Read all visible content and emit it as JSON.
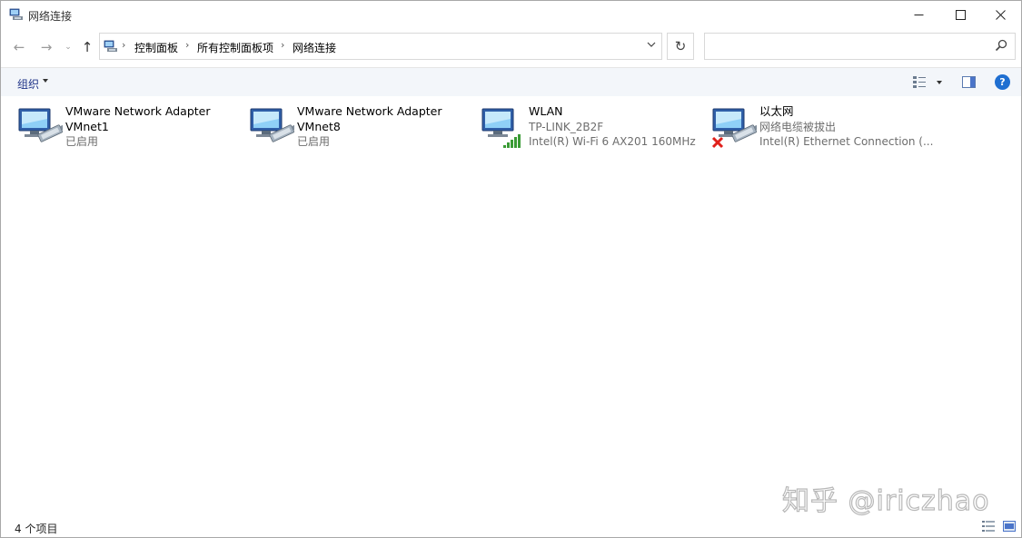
{
  "window": {
    "title": "网络连接",
    "minimize_icon": "minimize-icon",
    "maximize_icon": "maximize-icon",
    "close_icon": "close-icon"
  },
  "nav": {
    "back": "←",
    "forward": "→",
    "recent": "⌄",
    "up": "↑",
    "breadcrumb": [
      "控制面板",
      "所有控制面板项",
      "网络连接"
    ],
    "refresh": "↻",
    "search_placeholder": ""
  },
  "toolbar": {
    "organize_label": "组织",
    "help_label": "?"
  },
  "connections": [
    {
      "name": "VMware Network Adapter VMnet1",
      "name_line1": "VMware Network Adapter",
      "name_line2": "VMnet1",
      "status": "已启用",
      "device": "",
      "icon": "network-adapter-icon"
    },
    {
      "name": "VMware Network Adapter VMnet8",
      "name_line1": "VMware Network Adapter",
      "name_line2": "VMnet8",
      "status": "已启用",
      "device": "",
      "icon": "network-adapter-icon"
    },
    {
      "name": "WLAN",
      "name_line1": "WLAN",
      "name_line2": "",
      "status": "TP-LINK_2B2F",
      "device": "Intel(R) Wi-Fi 6 AX201 160MHz",
      "icon": "wifi-adapter-icon"
    },
    {
      "name": "以太网",
      "name_line1": "以太网",
      "name_line2": "",
      "status": "网络电缆被拔出",
      "device": "Intel(R) Ethernet Connection (...",
      "icon": "ethernet-disconnected-icon"
    }
  ],
  "watermark": "知乎 @iriczhao",
  "status_bar": {
    "item_count": "4 个项目"
  },
  "colors": {
    "command_bar_bg": "#f3f6fa",
    "organize_text": "#1e3287",
    "help_blue": "#1f6fd1",
    "wifi_signal": "#3a9b35",
    "disconnected_red": "#e0201b"
  }
}
